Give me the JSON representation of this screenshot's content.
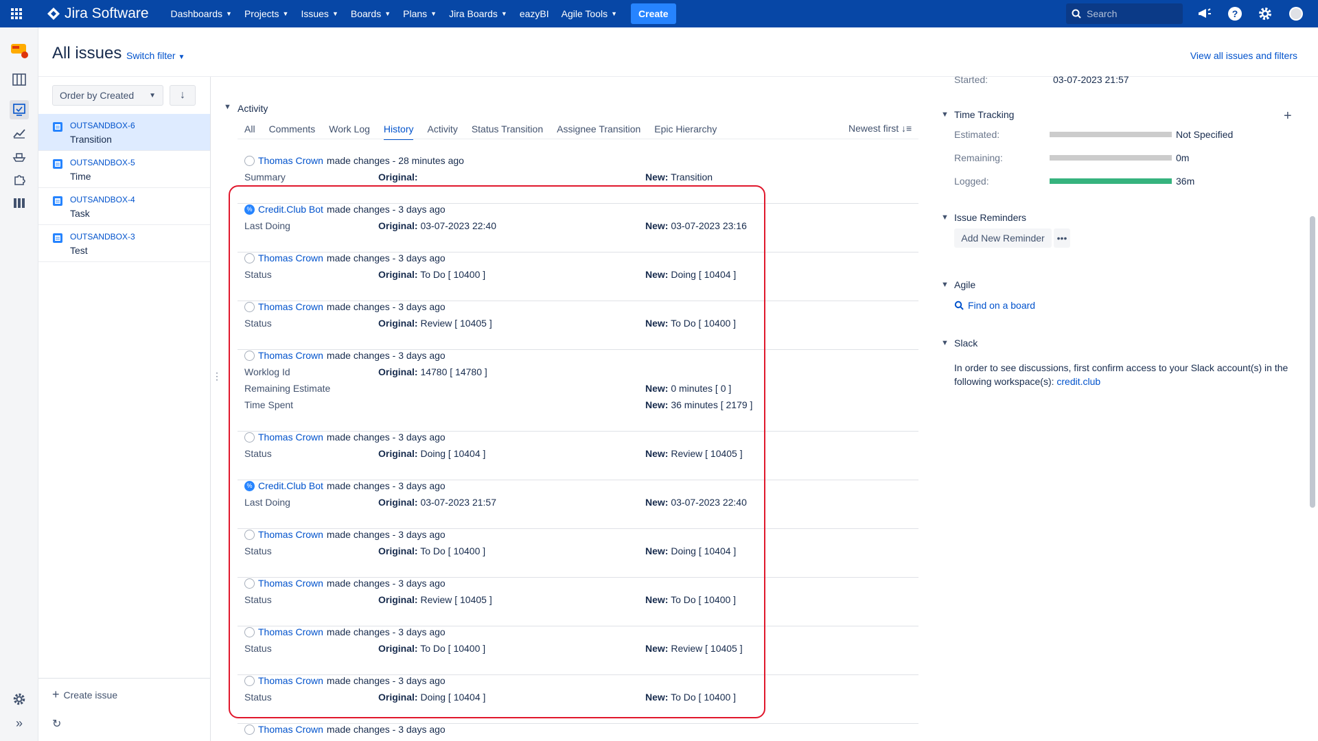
{
  "topnav": {
    "brand": "Jira Software",
    "items": [
      "Dashboards",
      "Projects",
      "Issues",
      "Boards",
      "Plans",
      "Jira Boards"
    ],
    "plain_items": [
      "eazyBI"
    ],
    "agile": "Agile Tools",
    "create": "Create",
    "search_placeholder": "Search"
  },
  "header": {
    "title": "All issues",
    "switch_filter": "Switch filter",
    "view_all": "View all issues and filters"
  },
  "issue_list": {
    "order_by": "Order by Created",
    "sort_icon": "arrow-down-icon",
    "issues": [
      {
        "key": "OUTSANDBOX-6",
        "summary": "Transition",
        "selected": true
      },
      {
        "key": "OUTSANDBOX-5",
        "summary": "Time",
        "selected": false
      },
      {
        "key": "OUTSANDBOX-4",
        "summary": "Task",
        "selected": false
      },
      {
        "key": "OUTSANDBOX-3",
        "summary": "Test",
        "selected": false
      }
    ],
    "create_issue": "Create issue"
  },
  "activity": {
    "title": "Activity",
    "tabs": [
      "All",
      "Comments",
      "Work Log",
      "History",
      "Activity",
      "Status Transition",
      "Assignee Transition",
      "Epic Hierarchy"
    ],
    "active_tab": "History",
    "order": "Newest first",
    "entries": [
      {
        "user": "Thomas Crown",
        "action": "made changes - 28 minutes ago",
        "bot": false,
        "rows": [
          {
            "field": "Summary",
            "original": "",
            "new": "Transition"
          }
        ]
      },
      {
        "user": "Credit.Club Bot",
        "action": "made changes - 3 days ago",
        "bot": true,
        "rows": [
          {
            "field": "Last Doing",
            "original": "03-07-2023 22:40",
            "new": "03-07-2023 23:16"
          }
        ]
      },
      {
        "user": "Thomas Crown",
        "action": "made changes - 3 days ago",
        "bot": false,
        "rows": [
          {
            "field": "Status",
            "original": "To Do [ 10400 ]",
            "new": "Doing [ 10404 ]"
          }
        ]
      },
      {
        "user": "Thomas Crown",
        "action": "made changes - 3 days ago",
        "bot": false,
        "rows": [
          {
            "field": "Status",
            "original": "Review [ 10405 ]",
            "new": "To Do [ 10400 ]"
          }
        ]
      },
      {
        "user": "Thomas Crown",
        "action": "made changes - 3 days ago",
        "bot": false,
        "rows": [
          {
            "field": "Worklog Id",
            "original": "14780 [ 14780 ]",
            "new": null
          },
          {
            "field": "Remaining Estimate",
            "original": null,
            "new": "0 minutes [ 0 ]"
          },
          {
            "field": "Time Spent",
            "original": null,
            "new": "36 minutes [ 2179 ]"
          }
        ]
      },
      {
        "user": "Thomas Crown",
        "action": "made changes - 3 days ago",
        "bot": false,
        "rows": [
          {
            "field": "Status",
            "original": "Doing [ 10404 ]",
            "new": "Review [ 10405 ]"
          }
        ]
      },
      {
        "user": "Credit.Club Bot",
        "action": "made changes - 3 days ago",
        "bot": true,
        "rows": [
          {
            "field": "Last Doing",
            "original": "03-07-2023 21:57",
            "new": "03-07-2023 22:40"
          }
        ]
      },
      {
        "user": "Thomas Crown",
        "action": "made changes - 3 days ago",
        "bot": false,
        "rows": [
          {
            "field": "Status",
            "original": "To Do [ 10400 ]",
            "new": "Doing [ 10404 ]"
          }
        ]
      },
      {
        "user": "Thomas Crown",
        "action": "made changes - 3 days ago",
        "bot": false,
        "rows": [
          {
            "field": "Status",
            "original": "Review [ 10405 ]",
            "new": "To Do [ 10400 ]"
          }
        ]
      },
      {
        "user": "Thomas Crown",
        "action": "made changes - 3 days ago",
        "bot": false,
        "rows": [
          {
            "field": "Status",
            "original": "To Do [ 10400 ]",
            "new": "Review [ 10405 ]"
          }
        ]
      },
      {
        "user": "Thomas Crown",
        "action": "made changes - 3 days ago",
        "bot": false,
        "rows": [
          {
            "field": "Status",
            "original": "Doing [ 10404 ]",
            "new": "To Do [ 10400 ]"
          }
        ]
      },
      {
        "user": "Thomas Crown",
        "action": "made changes - 3 days ago",
        "bot": false,
        "rows": []
      }
    ],
    "original_label": "Original:",
    "new_label": "New:"
  },
  "right_panel": {
    "started_label": "Started:",
    "started_value": "03-07-2023 21:57",
    "time_tracking": {
      "title": "Time Tracking",
      "estimated_label": "Estimated:",
      "estimated_value": "Not Specified",
      "estimated_fill": 0,
      "remaining_label": "Remaining:",
      "remaining_value": "0m",
      "remaining_fill": 0,
      "logged_label": "Logged:",
      "logged_value": "36m",
      "logged_fill": 1.0
    },
    "reminders": {
      "title": "Issue Reminders",
      "add": "Add New Reminder",
      "more": "•••"
    },
    "agile": {
      "title": "Agile",
      "find": "Find on a board"
    },
    "slack": {
      "title": "Slack",
      "text": "In order to see discussions, first confirm access to your Slack account(s) in the following workspace(s):",
      "link": "credit.club"
    }
  },
  "colors": {
    "nav": "#0747a6",
    "accent": "#0052cc",
    "highlight": "#e0162b",
    "logged": "#36b37e"
  }
}
